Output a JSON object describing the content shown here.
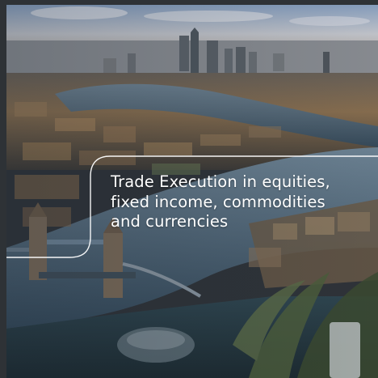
{
  "hero": {
    "headline_lines": [
      "Trade Execution in equities,",
      "fixed income, commodities",
      "and currencies"
    ]
  },
  "colors": {
    "outline": "#ffffff",
    "text": "#ffffff",
    "frame": "#2e3236"
  },
  "image": {
    "subject": "city-skyline-photo"
  }
}
